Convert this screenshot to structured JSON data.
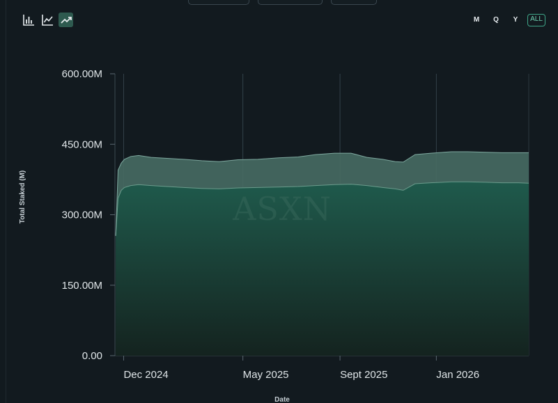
{
  "chart_types": [
    {
      "name": "bar-chart-icon",
      "active": false
    },
    {
      "name": "line-chart-icon",
      "active": false
    },
    {
      "name": "area-chart-icon",
      "active": true
    }
  ],
  "range_buttons": [
    "M",
    "Q",
    "Y",
    "ALL"
  ],
  "active_range": "ALL",
  "watermark": "ASXN",
  "colors": {
    "series_bottom": "#1f5a4c",
    "series_top": "#476b63",
    "line": "#6a9c8c"
  },
  "chart_data": {
    "type": "area",
    "stacked": true,
    "xlabel": "Date",
    "ylabel": "Total Staked (M)",
    "ylim": [
      0,
      600
    ],
    "yticks": [
      0,
      150,
      300,
      450,
      600
    ],
    "ytick_labels": [
      "0.00",
      "150.00M",
      "300.00M",
      "450.00M",
      "600.00M"
    ],
    "xtick_labels": [
      "Dec 2024",
      "May 2025",
      "Sept 2025",
      "Jan 2026"
    ],
    "xtick_dates": [
      "2024-12-01",
      "2025-05-01",
      "2025-09-01",
      "2026-01-01"
    ],
    "xlim": [
      "2024-11-20",
      "2026-04-28"
    ],
    "grid": "vertical",
    "x": [
      "2024-11-21",
      "2024-11-24",
      "2024-11-28",
      "2024-12-02",
      "2024-12-10",
      "2024-12-20",
      "2025-01-05",
      "2025-01-25",
      "2025-02-15",
      "2025-03-10",
      "2025-04-01",
      "2025-04-25",
      "2025-05-20",
      "2025-06-15",
      "2025-07-10",
      "2025-08-01",
      "2025-08-25",
      "2025-09-15",
      "2025-10-05",
      "2025-10-25",
      "2025-11-10",
      "2025-11-20",
      "2025-12-05",
      "2025-12-25",
      "2026-01-20",
      "2026-02-10",
      "2026-03-05",
      "2026-03-25",
      "2026-04-15",
      "2026-04-28"
    ],
    "series": [
      {
        "values": [
          255,
          335,
          352,
          358,
          362,
          364,
          362,
          360,
          358,
          356,
          355,
          357,
          358,
          359,
          360,
          362,
          364,
          365,
          362,
          358,
          355,
          352,
          366,
          368,
          370,
          370,
          369,
          368,
          368,
          367
        ]
      },
      {
        "values": [
          0,
          60,
          58,
          60,
          62,
          62,
          60,
          60,
          60,
          59,
          58,
          60,
          60,
          62,
          63,
          66,
          67,
          66,
          60,
          60,
          58,
          60,
          62,
          63,
          64,
          64,
          64,
          64,
          64,
          65
        ]
      }
    ]
  }
}
